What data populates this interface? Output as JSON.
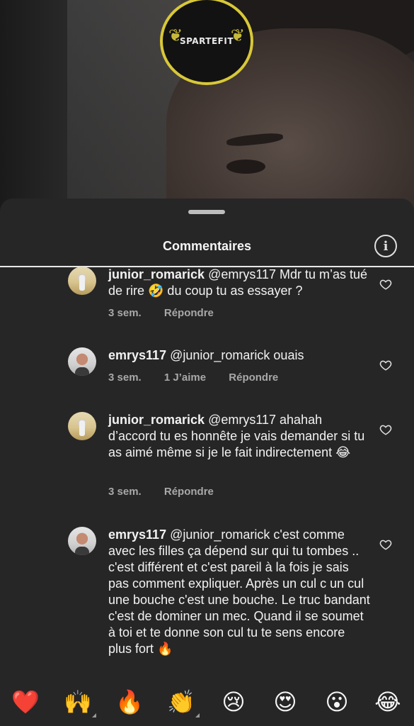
{
  "logo": {
    "text": "SPARTEFIT"
  },
  "sheet": {
    "title": "Commentaires",
    "info_icon": "info-icon"
  },
  "comments": [
    {
      "username": "junior_romarick",
      "text": "@emrys117 Mdr tu m’as tué de rire 🤣 du coup tu as essayer ?",
      "time": "3 sem.",
      "likes": "",
      "reply": "Répondre"
    },
    {
      "username": "emrys117",
      "text": "@junior_romarick ouais",
      "time": "3 sem.",
      "likes": "1 J’aime",
      "reply": "Répondre"
    },
    {
      "username": "junior_romarick",
      "text": "@emrys117 ahahah d’accord tu es honnête je vais demander si tu as aimé même si je le fait indirectement 😂",
      "time": "3 sem.",
      "likes": "",
      "reply": "Répondre"
    },
    {
      "username": "emrys117",
      "text": "@junior_romarick c'est comme avec les filles ça dépend sur qui tu tombes .. c'est différent et c'est pareil à la fois je sais pas comment expliquer. Après un cul c un cul une bouche c'est une bouche. Le truc bandant c'est de dominer un mec. Quand il se soumet à toi et te donne son cul tu te sens encore plus fort 🔥",
      "time": "",
      "likes": "",
      "reply": ""
    }
  ],
  "emoji_bar": [
    "❤️",
    "🙌",
    "🔥",
    "👏",
    "😢",
    "😍",
    "😮",
    "😂"
  ],
  "colors": {
    "background": "#262626",
    "logo_ring": "#d8c838",
    "meta_text": "#a8a8a8"
  }
}
